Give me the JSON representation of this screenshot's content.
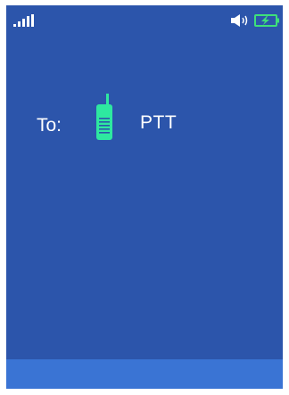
{
  "status_bar": {
    "signal_icon": "signal-strength-icon",
    "volume_icon": "speaker-volume-icon",
    "battery_icon": "battery-charging-icon",
    "battery_color": "#3ee07a"
  },
  "call": {
    "to_label": "To:",
    "target_icon": "walkie-talkie-icon",
    "target_name": "PTT",
    "icon_color": "#2ee8a0"
  },
  "colors": {
    "screen_background": "#2c55ab",
    "softkey_bar": "#3a74d4"
  }
}
